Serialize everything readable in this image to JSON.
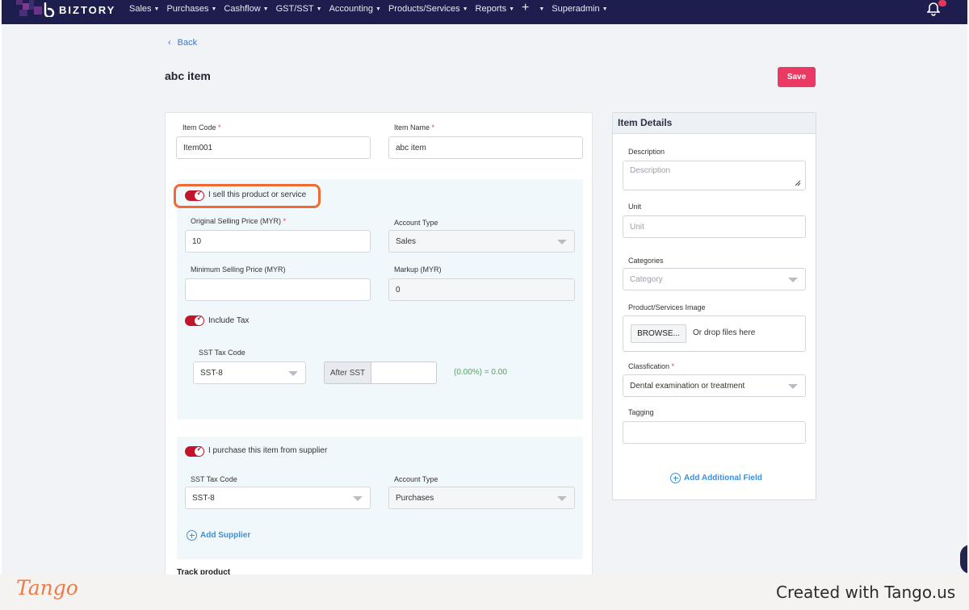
{
  "nav": {
    "brand": "BIZTORY",
    "menu": [
      {
        "label": "Sales"
      },
      {
        "label": "Purchases"
      },
      {
        "label": "Cashflow"
      },
      {
        "label": "GST/SST"
      },
      {
        "label": "Accounting"
      },
      {
        "label": "Products/Services"
      },
      {
        "label": "Reports"
      }
    ],
    "plus_label": "+",
    "superadmin": "Superadmin"
  },
  "header": {
    "back": "Back",
    "title": "abc item",
    "save": "Save"
  },
  "item": {
    "code_label": "Item Code",
    "code_value": "Item001",
    "name_label": "Item Name",
    "name_value": "abc item",
    "required_mark": "*"
  },
  "sell": {
    "toggle_label": "I sell this product or service",
    "orig_price_label": "Original Selling Price (MYR)",
    "orig_price_value": "10",
    "account_type_label": "Account Type",
    "account_type_value": "Sales",
    "min_price_label": "Minimum Selling Price (MYR)",
    "min_price_value": "",
    "markup_label": "Markup (MYR)",
    "markup_value": "0",
    "include_tax_label": "Include Tax",
    "sst_label": "SST Tax Code",
    "sst_value": "SST-8",
    "after_sst": "After SST",
    "tax_result": "(0.00%) = 0.00"
  },
  "purchase": {
    "toggle_label": "I purchase this item from supplier",
    "sst_label": "SST Tax Code",
    "sst_value": "SST-8",
    "account_type_label": "Account Type",
    "account_type_value": "Purchases",
    "add_supplier": "Add Supplier",
    "track_product": "Track product"
  },
  "details": {
    "title": "Item Details",
    "description_label": "Description",
    "description_placeholder": "Description",
    "unit_label": "Unit",
    "unit_placeholder": "Unit",
    "categories_label": "Categories",
    "categories_placeholder": "Category",
    "image_label": "Product/Services Image",
    "browse": "BROWSE...",
    "drop": "Or drop files here",
    "classification_label": "Classfication",
    "classification_value": "Dental examination or treatment",
    "tagging_label": "Tagging",
    "add_field": "Add Additional Field"
  },
  "footer": {
    "logo": "Tango",
    "credit": "Created with Tango.us"
  },
  "colors": {
    "nav_bg": "#1d1e4e",
    "accent": "#ea3a64",
    "toggle_on": "#c2142b",
    "link": "#3e8fd8",
    "highlight": "#f06a35"
  }
}
